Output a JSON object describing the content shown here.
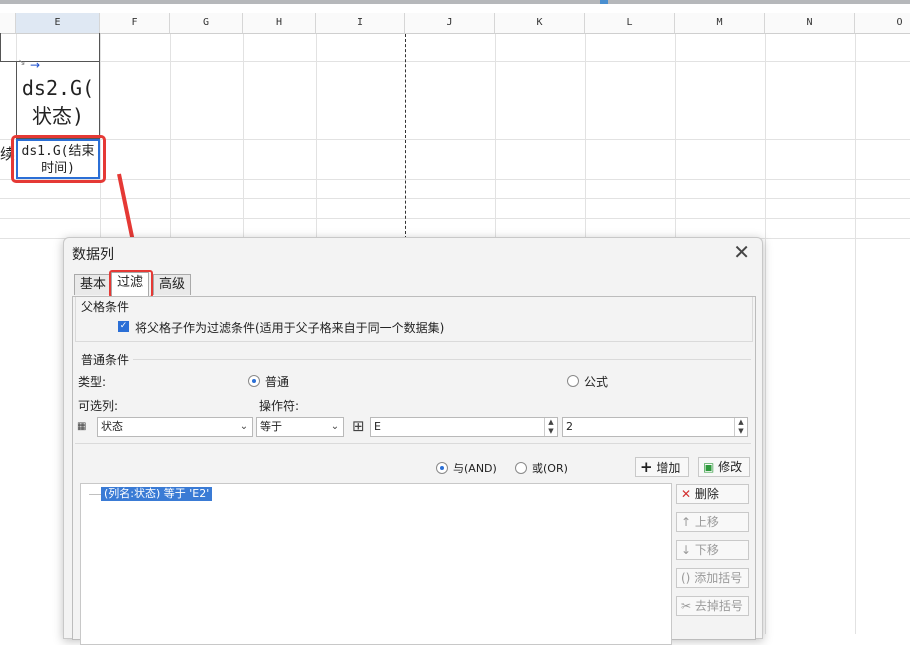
{
  "spreadsheet": {
    "columns": [
      "E",
      "F",
      "G",
      "H",
      "I",
      "J",
      "K",
      "L",
      "M",
      "N",
      "O"
    ],
    "cell_e2": "ds2.G(状态)",
    "cell_e2_line1": "ds2.G(",
    "cell_e2_line2": "状态)",
    "cell_e3_line1": "ds1.G(结束",
    "cell_e3_line2": "时间)",
    "partial_left_char": "续"
  },
  "dialog": {
    "title": "数据列",
    "tabs": [
      "基本",
      "过滤",
      "高级"
    ],
    "active_tab": "过滤",
    "parent_section": "父格条件",
    "parent_checkbox_label": "将父格子作为过滤条件(适用于父子格来自于同一个数据集)",
    "parent_checked": true,
    "normal_section": "普通条件",
    "type_label": "类型:",
    "type_options": [
      "普通",
      "公式"
    ],
    "type_selected": "普通",
    "column_label": "可选列:",
    "operator_label": "操作符:",
    "column_value": "状态",
    "operator_value": "等于",
    "value1": "E",
    "value2": "2",
    "logic_and": "与(AND)",
    "logic_or": "或(OR)",
    "logic_selected": "与(AND)",
    "add_label": "增加",
    "modify_label": "修改",
    "condition_item": "(列名:状态) 等于 'E2'",
    "side_buttons": [
      "删除",
      "上移",
      "下移",
      "添加括号",
      "去掉括号"
    ]
  },
  "colors": {
    "accent": "#2b6fd6",
    "highlight": "#e53935"
  }
}
